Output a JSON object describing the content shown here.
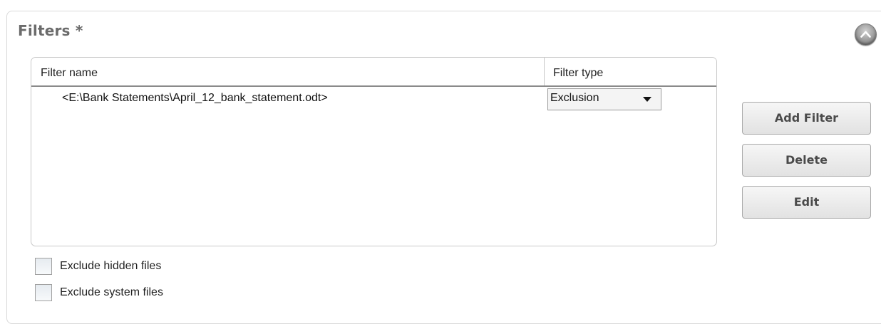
{
  "panel": {
    "title": "Filters *",
    "collapse_icon": "chevron-up-icon"
  },
  "table": {
    "columns": [
      "Filter name",
      "Filter type"
    ],
    "rows": [
      {
        "name": "<E:\\Bank Statements\\April_12_bank_statement.odt>",
        "type": "Exclusion"
      }
    ]
  },
  "buttons": {
    "add_filter": "Add Filter",
    "delete": "Delete",
    "edit": "Edit"
  },
  "options": {
    "exclude_hidden": {
      "label": "Exclude hidden files",
      "checked": false
    },
    "exclude_system": {
      "label": "Exclude system files",
      "checked": false
    }
  },
  "colors": {
    "title": "#6b6b6b",
    "button_text": "#4a4a4a",
    "border": "#c8c8c8"
  }
}
